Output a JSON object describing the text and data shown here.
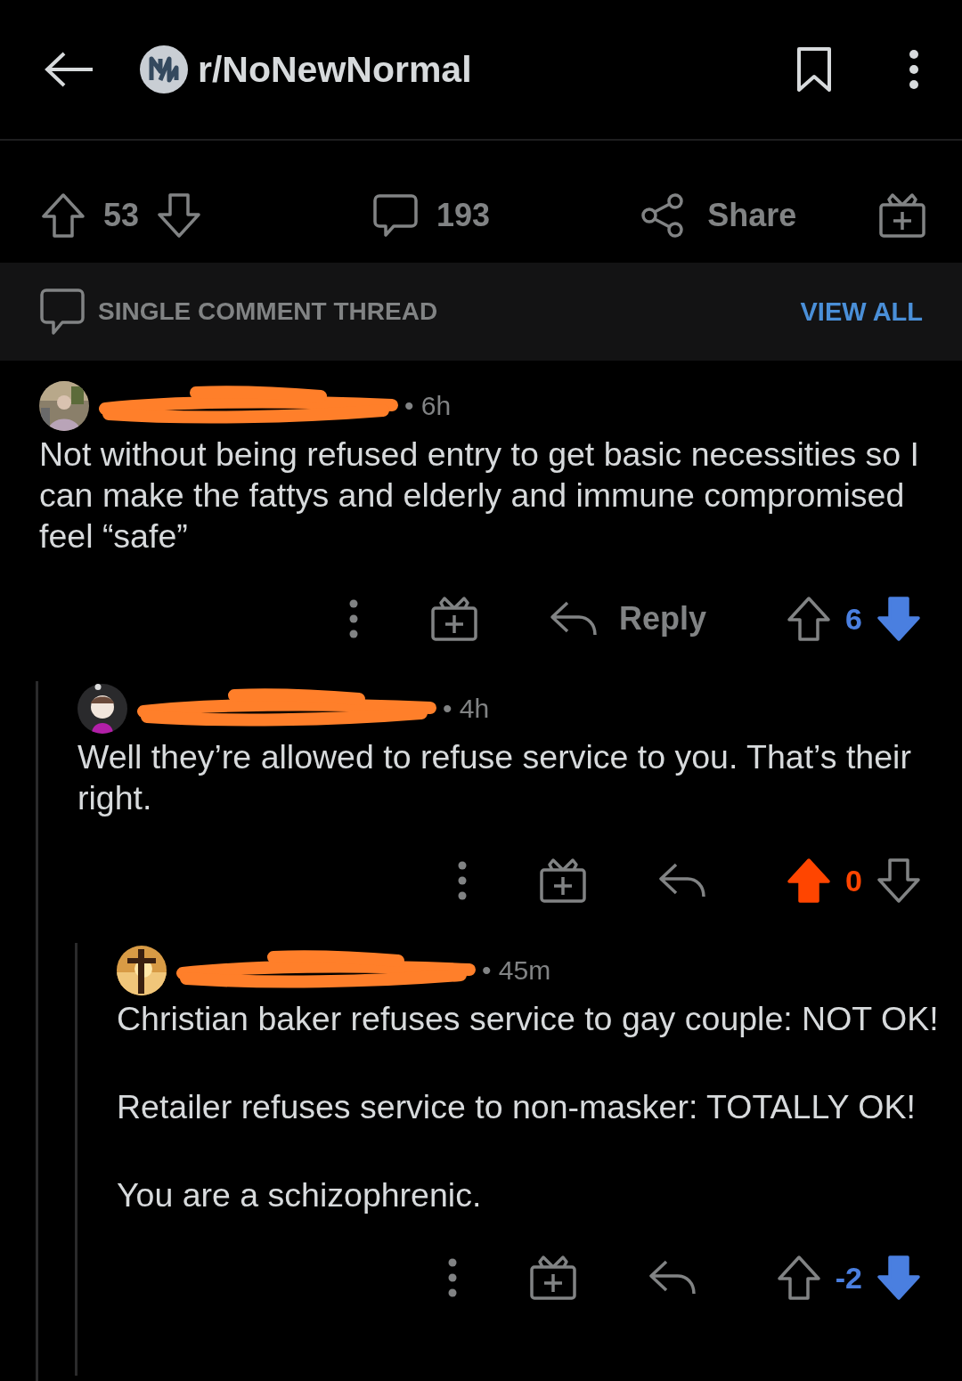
{
  "header": {
    "subreddit": "r/NoNewNormal"
  },
  "post_actions": {
    "score": "53",
    "comments": "193",
    "share": "Share"
  },
  "thread_bar": {
    "label": "SINGLE COMMENT THREAD",
    "link": "VIEW ALL"
  },
  "comments": [
    {
      "author_redacted": true,
      "time": "• 6h",
      "body": [
        "Not without being refused entry to get basic necessities so I can make the fattys and elderly and immune compromised feel “safe”"
      ],
      "reply_label": "Reply",
      "score": "6",
      "upvoted": false,
      "downvoted": true,
      "children": [
        {
          "author_redacted": true,
          "time": "• 4h",
          "body": [
            "Well they’re allowed to refuse service to you. That’s their right."
          ],
          "score": "0",
          "upvoted": true,
          "downvoted": false,
          "children": [
            {
              "author_redacted": true,
              "time": "• 45m",
              "body": [
                "Christian baker refuses service to gay couple: NOT OK!",
                "Retailer refuses service to non-masker: TOTALLY OK!",
                "You are a schizophrenic."
              ],
              "score": "-2",
              "upvoted": false,
              "downvoted": true
            }
          ]
        }
      ]
    }
  ]
}
